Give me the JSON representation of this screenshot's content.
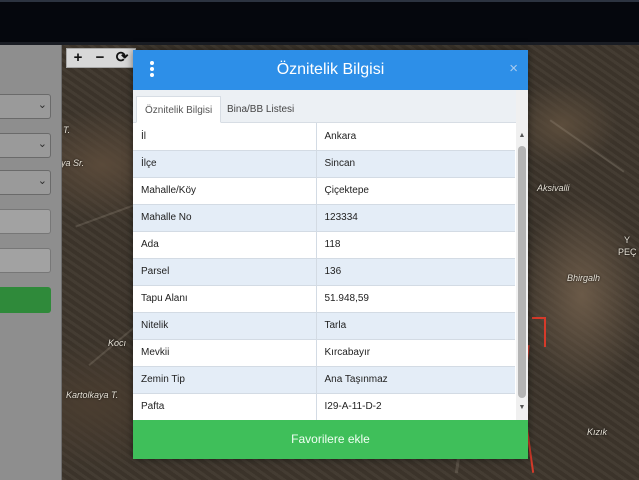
{
  "modal": {
    "title": "Öznitelik Bilgisi",
    "close_symbol": "×",
    "tabs": [
      {
        "label": "Öznitelik Bilgisi",
        "active": true
      },
      {
        "label": "Bina/BB Listesi",
        "active": false
      }
    ],
    "rows": [
      {
        "key": "İl",
        "value": "Ankara"
      },
      {
        "key": "İlçe",
        "value": "Sincan"
      },
      {
        "key": "Mahalle/Köy",
        "value": "Çiçektepe"
      },
      {
        "key": "Mahalle No",
        "value": "123334"
      },
      {
        "key": "Ada",
        "value": "118"
      },
      {
        "key": "Parsel",
        "value": "136"
      },
      {
        "key": "Tapu Alanı",
        "value": "51.948,59"
      },
      {
        "key": "Nitelik",
        "value": "Tarla"
      },
      {
        "key": "Mevkii",
        "value": "Kırcabayır"
      },
      {
        "key": "Zemin Tip",
        "value": "Ana Taşınmaz"
      },
      {
        "key": "Pafta",
        "value": "I29-A-11-D-2"
      }
    ],
    "favorite_button": "Favorilere ekle",
    "header_color": "#2d8fe8",
    "button_color": "#3fbf5a"
  },
  "map_tools": {
    "zoom_in": "+",
    "zoom_out": "−",
    "refresh": "⟳"
  },
  "map_labels": {
    "l1": "T.",
    "l2": "aya Sr.",
    "l3": "Aksivalli",
    "l4": "Y",
    "l5": "PEÇ",
    "l6": "Kocı",
    "l7": "Kartolkaya T.",
    "l8": "Bhirgalh",
    "l9": "Kızık"
  },
  "left_panel": {
    "chevron": "⌄"
  }
}
